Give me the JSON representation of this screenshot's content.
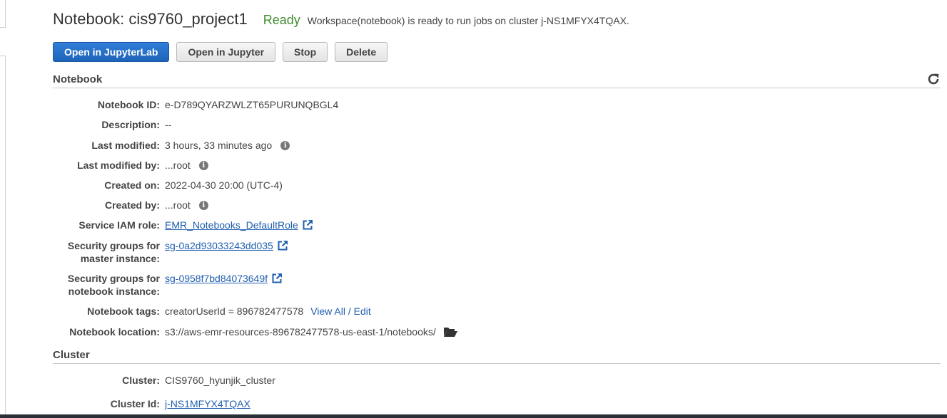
{
  "header": {
    "title": "Notebook: cis9760_project1",
    "status": "Ready",
    "status_message": "Workspace(notebook) is ready to run jobs on cluster j-NS1MFYX4TQAX."
  },
  "toolbar": {
    "open_jupyterlab": "Open in JupyterLab",
    "open_jupyter": "Open in Jupyter",
    "stop": "Stop",
    "delete": "Delete"
  },
  "notebook_section": {
    "title": "Notebook",
    "notebook_id": {
      "label": "Notebook ID:",
      "value": "e-D789QYARZWLZT65PURUNQBGL4"
    },
    "description": {
      "label": "Description:",
      "value": "--"
    },
    "last_modified": {
      "label": "Last modified:",
      "value": "3 hours, 33 minutes ago"
    },
    "last_modified_by": {
      "label": "Last modified by:",
      "value": "...root"
    },
    "created_on": {
      "label": "Created on:",
      "value": "2022-04-30 20:00 (UTC-4)"
    },
    "created_by": {
      "label": "Created by:",
      "value": "...root"
    },
    "service_iam_role": {
      "label": "Service IAM role:",
      "value": "EMR_Notebooks_DefaultRole"
    },
    "sg_master": {
      "label_line1": "Security groups for",
      "label_line2": "master instance:",
      "value": "sg-0a2d93033243dd035"
    },
    "sg_notebook": {
      "label_line1": "Security groups for",
      "label_line2": "notebook instance:",
      "value": "sg-0958f7bd84073649f"
    },
    "tags": {
      "label": "Notebook tags:",
      "value": "creatorUserId = 896782477578",
      "link": "View All / Edit"
    },
    "location": {
      "label": "Notebook location:",
      "value": "s3://aws-emr-resources-896782477578-us-east-1/notebooks/"
    }
  },
  "cluster_section": {
    "title": "Cluster",
    "cluster": {
      "label": "Cluster:",
      "value": "CIS9760_hyunjik_cluster"
    },
    "cluster_id": {
      "label": "Cluster Id:",
      "value": "j-NS1MFYX4TQAX"
    }
  },
  "icons": {
    "info": "info-icon",
    "external_link": "external-link-icon",
    "folder": "folder-open-icon",
    "refresh": "refresh-icon"
  },
  "colors": {
    "primary_button": "#1f63b9",
    "status_ready": "#3f8f2f",
    "link": "#1f5fb0"
  }
}
